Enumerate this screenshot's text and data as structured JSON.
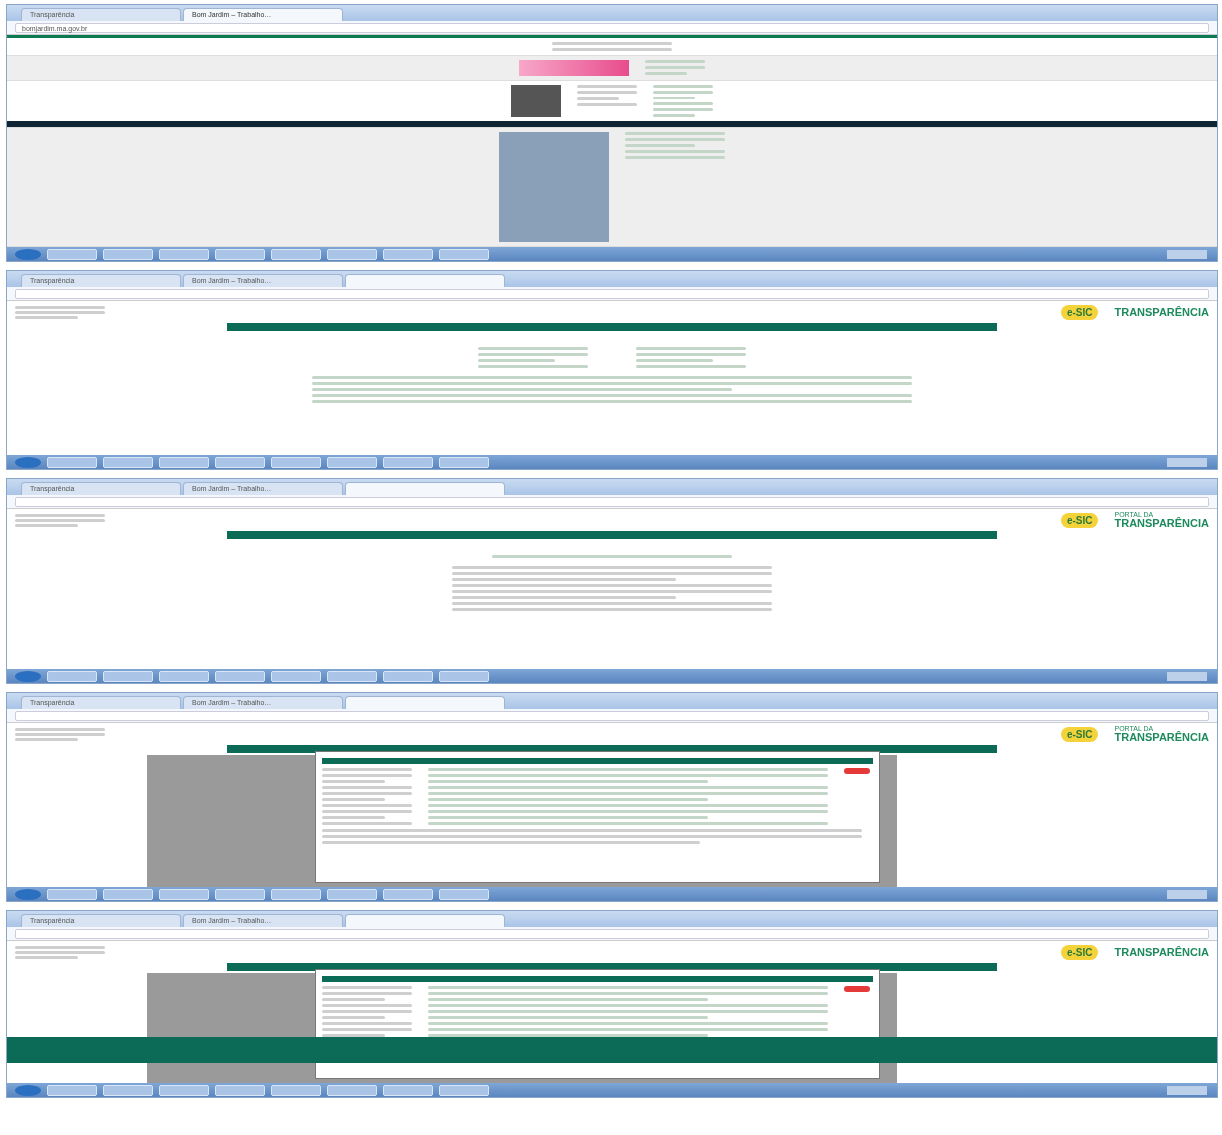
{
  "screenshots": [
    {
      "kind": "home",
      "tabs": [
        {
          "label": "Transparência",
          "selected": false
        },
        {
          "label": "Bom Jardim – Trabalho…",
          "selected": true
        }
      ],
      "address": "bomjardim.ma.gov.br"
    },
    {
      "kind": "portal",
      "tabs": [
        {
          "label": "Transparência",
          "selected": false
        },
        {
          "label": "Bom Jardim – Trabalho…",
          "selected": false
        },
        {
          "selected": true
        }
      ],
      "portal": {
        "esic": "e-SIC",
        "title_main": "TRANSPARÊNCIA"
      },
      "page": {
        "kind": "info"
      },
      "modal": false,
      "footer": false
    },
    {
      "kind": "portal",
      "tabs": [
        {
          "label": "Transparência",
          "selected": false
        },
        {
          "label": "Bom Jardim – Trabalho…",
          "selected": false
        },
        {
          "selected": true
        }
      ],
      "portal": {
        "esic": "e-SIC",
        "title_top": "PORTAL DA",
        "title_main": "TRANSPARÊNCIA"
      },
      "page": {
        "kind": "notice"
      },
      "modal": false,
      "footer": false
    },
    {
      "kind": "portal",
      "tabs": [
        {
          "label": "Transparência",
          "selected": false
        },
        {
          "label": "Bom Jardim – Trabalho…",
          "selected": false
        },
        {
          "selected": true
        }
      ],
      "portal": {
        "esic": "e-SIC",
        "title_top": "PORTAL DA",
        "title_main": "TRANSPARÊNCIA"
      },
      "page": {
        "kind": "table"
      },
      "modal": true,
      "footer": false
    },
    {
      "kind": "portal",
      "tabs": [
        {
          "label": "Transparência",
          "selected": false
        },
        {
          "label": "Bom Jardim – Trabalho…",
          "selected": false
        },
        {
          "selected": true
        }
      ],
      "portal": {
        "esic": "e-SIC",
        "title_main": "TRANSPARÊNCIA"
      },
      "page": {
        "kind": "table"
      },
      "modal": true,
      "footer": true
    }
  ]
}
